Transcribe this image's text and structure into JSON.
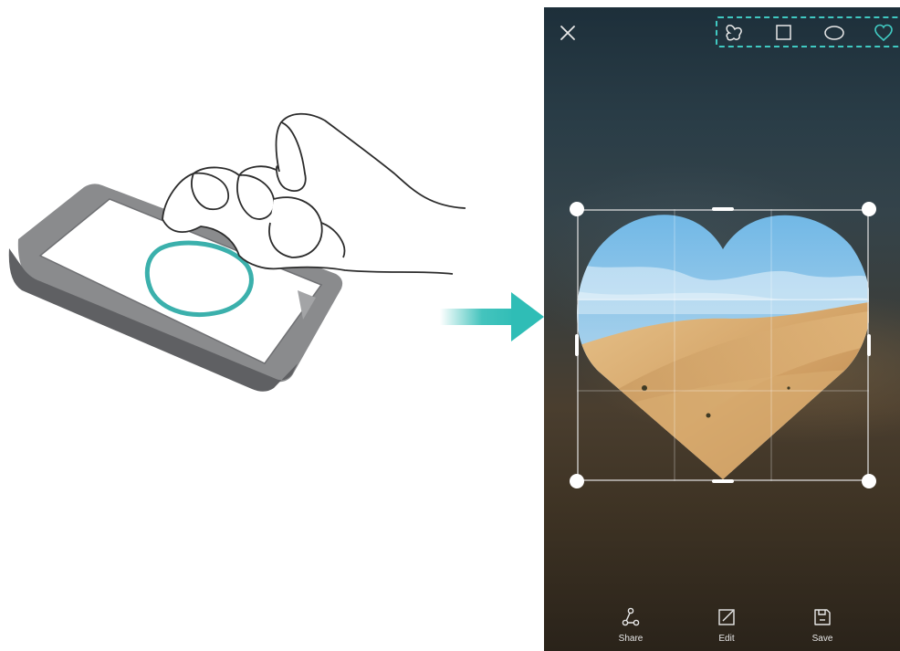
{
  "illustration": {
    "gesture": "knuckle-draw-circle",
    "phone_icon": "phone-icon",
    "hand_icon": "knuckle-hand-icon",
    "stroke_color": "#3bb0ac",
    "arrow_color": "#2fbdb6"
  },
  "screen": {
    "close_icon": "close-icon",
    "shape_tools": [
      {
        "name": "freeform",
        "icon": "freeform-shape-icon",
        "selected": false
      },
      {
        "name": "square",
        "icon": "square-shape-icon",
        "selected": false
      },
      {
        "name": "oval",
        "icon": "oval-shape-icon",
        "selected": false
      },
      {
        "name": "heart",
        "icon": "heart-shape-icon",
        "selected": true
      }
    ],
    "selected_shape": "heart",
    "accent_color": "#40c9c2",
    "actions": [
      {
        "label": "Share",
        "icon": "share-icon"
      },
      {
        "label": "Edit",
        "icon": "edit-icon"
      },
      {
        "label": "Save",
        "icon": "save-icon"
      }
    ]
  }
}
